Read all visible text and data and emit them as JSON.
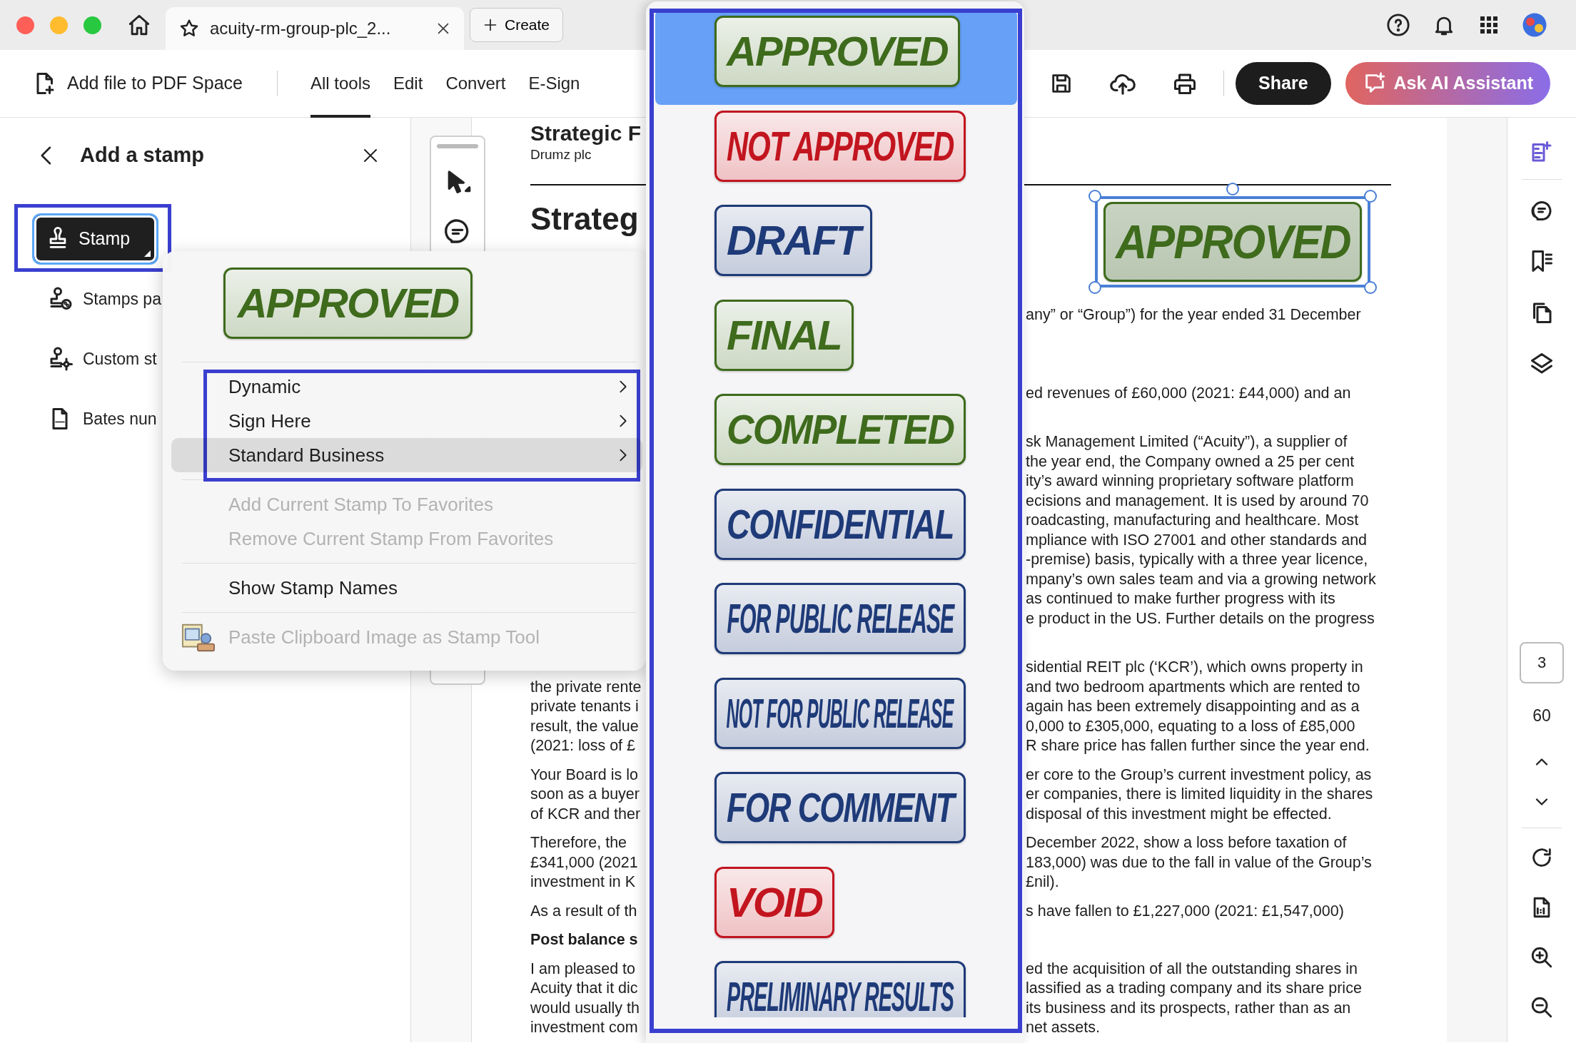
{
  "window": {
    "tab_title": "acuity-rm-group-plc_2...",
    "new_tab": "Create"
  },
  "toolbar": {
    "add_file": "Add file to PDF Space",
    "tabs": [
      {
        "label": "All tools",
        "selected": true
      },
      {
        "label": "Edit",
        "selected": false
      },
      {
        "label": "Convert",
        "selected": false
      },
      {
        "label": "E-Sign",
        "selected": false
      }
    ],
    "share": "Share",
    "ai": "Ask AI Assistant"
  },
  "panel": {
    "title": "Add a stamp",
    "tool": {
      "label": "Stamp",
      "active": true
    },
    "items": [
      {
        "label": "Stamps pa",
        "kind": "palette"
      },
      {
        "label": "Custom st",
        "kind": "custom"
      },
      {
        "label": "Bates nun",
        "kind": "bates"
      }
    ]
  },
  "stamp_menu": {
    "preview": {
      "label": "APPROVED",
      "color": "#3e6b1c"
    },
    "groups": [
      {
        "items": [
          {
            "label": "Dynamic",
            "kind": "submenu",
            "selected": false
          },
          {
            "label": "Sign Here",
            "kind": "submenu",
            "selected": false
          },
          {
            "label": "Standard Business",
            "kind": "submenu",
            "selected": true
          }
        ]
      },
      {
        "items": [
          {
            "label": "Add Current Stamp To Favorites",
            "kind": "action",
            "disabled": true
          },
          {
            "label": "Remove Current Stamp From Favorites",
            "kind": "action",
            "disabled": true
          }
        ]
      },
      {
        "items": [
          {
            "label": "Show Stamp Names",
            "kind": "action",
            "disabled": false
          }
        ]
      },
      {
        "items": [
          {
            "label": "Paste Clipboard Image as Stamp Tool",
            "kind": "image_action",
            "disabled": true
          }
        ]
      }
    ]
  },
  "stamp_list": {
    "stamps": [
      {
        "label": "APPROVED",
        "color": "#3e6b1c",
        "selected": true
      },
      {
        "label": "NOT APPROVED",
        "color": "#c2151f",
        "selected": false
      },
      {
        "label": "DRAFT",
        "color": "#1e3a78",
        "selected": false
      },
      {
        "label": "FINAL",
        "color": "#3e6b1c",
        "selected": false
      },
      {
        "label": "COMPLETED",
        "color": "#3e6b1c",
        "selected": false
      },
      {
        "label": "CONFIDENTIAL",
        "color": "#1e3a78",
        "selected": false
      },
      {
        "label": "FOR PUBLIC RELEASE",
        "color": "#1e3a78",
        "selected": false
      },
      {
        "label": "NOT FOR PUBLIC RELEASE",
        "color": "#1e3a78",
        "selected": false
      },
      {
        "label": "FOR COMMENT",
        "color": "#1e3a78",
        "selected": false
      },
      {
        "label": "VOID",
        "color": "#c2151f",
        "selected": false
      },
      {
        "label": "PRELIMINARY RESULTS",
        "color": "#1e3a78",
        "selected": false
      }
    ]
  },
  "document": {
    "title": "Strategic F",
    "company": "Drumz plc",
    "heading": "Strateg",
    "placed_stamp": {
      "label": "APPROVED",
      "color": "#3e6b1c",
      "selected": true
    },
    "blocks": [
      {
        "lines": [
          {
            "right": "any” or “Group”) for the year ended 31 December"
          }
        ]
      },
      {
        "lines": [
          {
            "right": "ed revenues of £60,000 (2021: £44,000) and an"
          }
        ]
      },
      {
        "lines": [
          {
            "right": "sk Management Limited (“Acuity”), a supplier of"
          },
          {
            "right": "the year end, the Company owned a 25 per cent"
          },
          {
            "right": "ity’s award winning proprietary software platform"
          },
          {
            "right": "ecisions and management. It is used by around 70"
          },
          {
            "right": "roadcasting, manufacturing and healthcare. Most"
          },
          {
            "right": "mpliance with ISO 27001 and other standards and"
          },
          {
            "right": "-premise) basis, typically with a three year licence,"
          },
          {
            "right": "mpany’s own sales team and via a growing network"
          },
          {
            "right": "as continued to make further progress with its"
          },
          {
            "right": "e product in the US. Further details on the progress"
          }
        ]
      },
      {
        "lines": [
          {
            "right": "sidential REIT plc (‘KCR’), which owns property in"
          },
          {
            "left": "the private rente",
            "right": "and two bedroom apartments which are rented to"
          },
          {
            "left": "private tenants i",
            "right": "again has been extremely disappointing and as a"
          },
          {
            "left": "result, the value",
            "right": "0,000 to £305,000, equating to a loss of £85,000"
          },
          {
            "left": "(2021: loss of £",
            "right": "R share price has fallen further since the year end."
          }
        ]
      },
      {
        "lines": [
          {
            "left": "Your Board is lo",
            "right": "er core to the Group’s current investment policy, as"
          },
          {
            "left": "soon as a buyer",
            "right": "er companies, there is limited liquidity in the shares"
          },
          {
            "left": "of KCR and ther",
            "right": "disposal of this investment might be effected."
          }
        ]
      },
      {
        "lines": [
          {
            "left": "Therefore, the",
            "right": "December 2022, show a loss before taxation of"
          },
          {
            "left": "£341,000 (2021",
            "right": "183,000) was due to the fall in value of the Group’s"
          },
          {
            "left": "investment in K",
            "right": "£nil)."
          }
        ]
      },
      {
        "lines": [
          {
            "left": "As a result of th",
            "right": "s have fallen to £1,227,000 (2021: £1,547,000)"
          }
        ]
      },
      {
        "kind": "heading",
        "lines": [
          {
            "left": "Post balance s"
          }
        ]
      },
      {
        "lines": [
          {
            "left": "I am pleased to",
            "right": "ed the acquisition of all the outstanding shares in"
          },
          {
            "left": "Acuity that it dic",
            "right": "lassified as a trading company and its share price"
          },
          {
            "left": "would usually th",
            "right": "its business and its prospects, rather than as an"
          },
          {
            "left": "investment com",
            "right": "net assets."
          }
        ]
      }
    ]
  },
  "page_nav": {
    "current": "3",
    "total": "60"
  }
}
